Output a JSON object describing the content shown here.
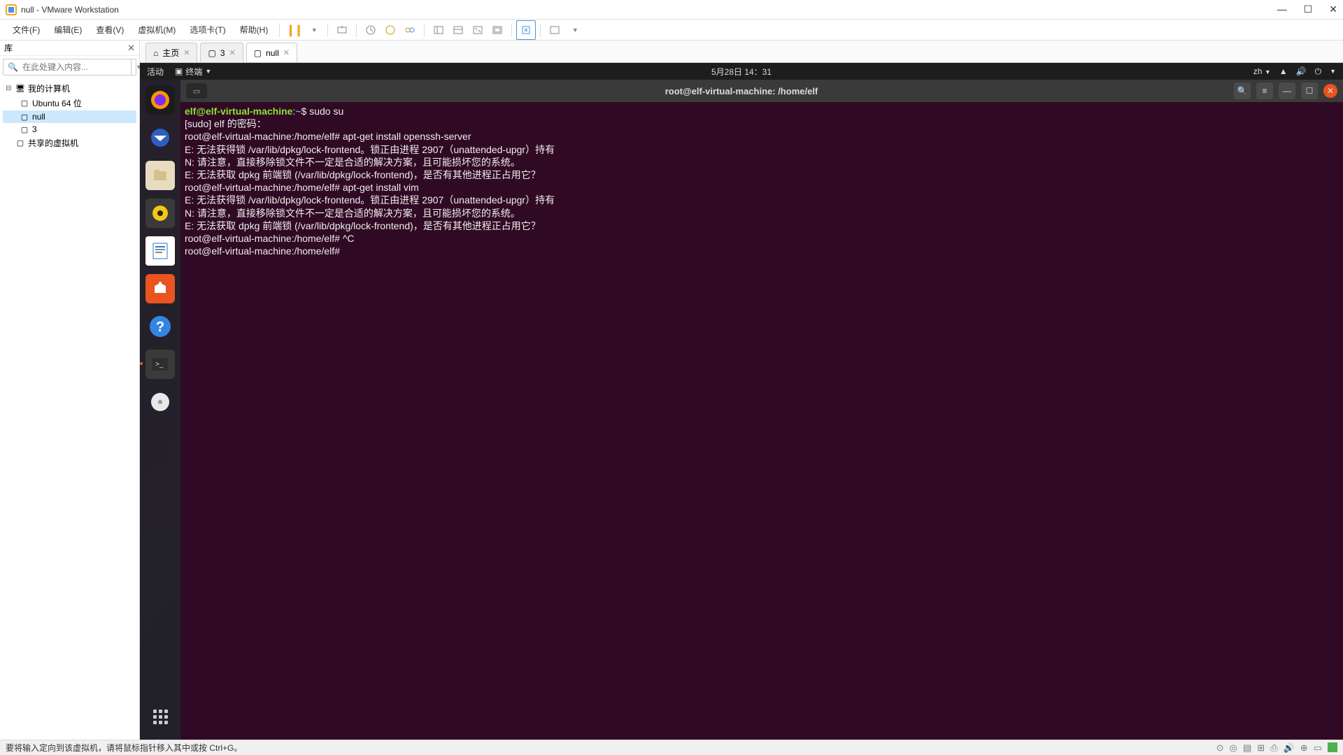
{
  "titlebar": {
    "title": "null - VMware Workstation"
  },
  "menus": {
    "file": "文件(F)",
    "edit": "编辑(E)",
    "view": "查看(V)",
    "vm": "虚拟机(M)",
    "tabs": "选项卡(T)",
    "help": "帮助(H)"
  },
  "sidebar": {
    "header": "库",
    "search_placeholder": "在此处键入内容...",
    "root": "我的计算机",
    "items": [
      "Ubuntu 64 位",
      "null",
      "3"
    ],
    "shared": "共享的虚拟机"
  },
  "tabs": [
    {
      "icon": "home",
      "label": "主页"
    },
    {
      "icon": "vm",
      "label": "3"
    },
    {
      "icon": "vm",
      "label": "null",
      "active": true
    }
  ],
  "ubuntu": {
    "activities": "活动",
    "terminal_label": "终端",
    "clock": "5月28日 14：31",
    "lang": "zh",
    "window_title": "root@elf-virtual-machine: /home/elf"
  },
  "terminal": {
    "lines": [
      {
        "prompt_user": "elf@elf-virtual-machine",
        "prompt_path": "~",
        "prompt_sym": "$",
        "cmd": "sudo su"
      },
      {
        "plain": "[sudo] elf 的密码："
      },
      {
        "plain": "root@elf-virtual-machine:/home/elf# apt-get install openssh-server"
      },
      {
        "plain": "E: 无法获得锁 /var/lib/dpkg/lock-frontend。锁正由进程 2907（unattended-upgr）持有"
      },
      {
        "plain": "N: 请注意，直接移除锁文件不一定是合适的解决方案，且可能损坏您的系统。"
      },
      {
        "plain": "E: 无法获取 dpkg 前端锁 (/var/lib/dpkg/lock-frontend)，是否有其他进程正占用它？"
      },
      {
        "plain": "root@elf-virtual-machine:/home/elf# apt-get install vim"
      },
      {
        "plain": "E: 无法获得锁 /var/lib/dpkg/lock-frontend。锁正由进程 2907（unattended-upgr）持有"
      },
      {
        "plain": "N: 请注意，直接移除锁文件不一定是合适的解决方案，且可能损坏您的系统。"
      },
      {
        "plain": "E: 无法获取 dpkg 前端锁 (/var/lib/dpkg/lock-frontend)，是否有其他进程正占用它？"
      },
      {
        "plain": "root@elf-virtual-machine:/home/elf# ^C"
      },
      {
        "plain": "root@elf-virtual-machine:/home/elf# "
      }
    ]
  },
  "statusbar": {
    "text": "要将输入定向到该虚拟机，请将鼠标指针移入其中或按 Ctrl+G。"
  }
}
